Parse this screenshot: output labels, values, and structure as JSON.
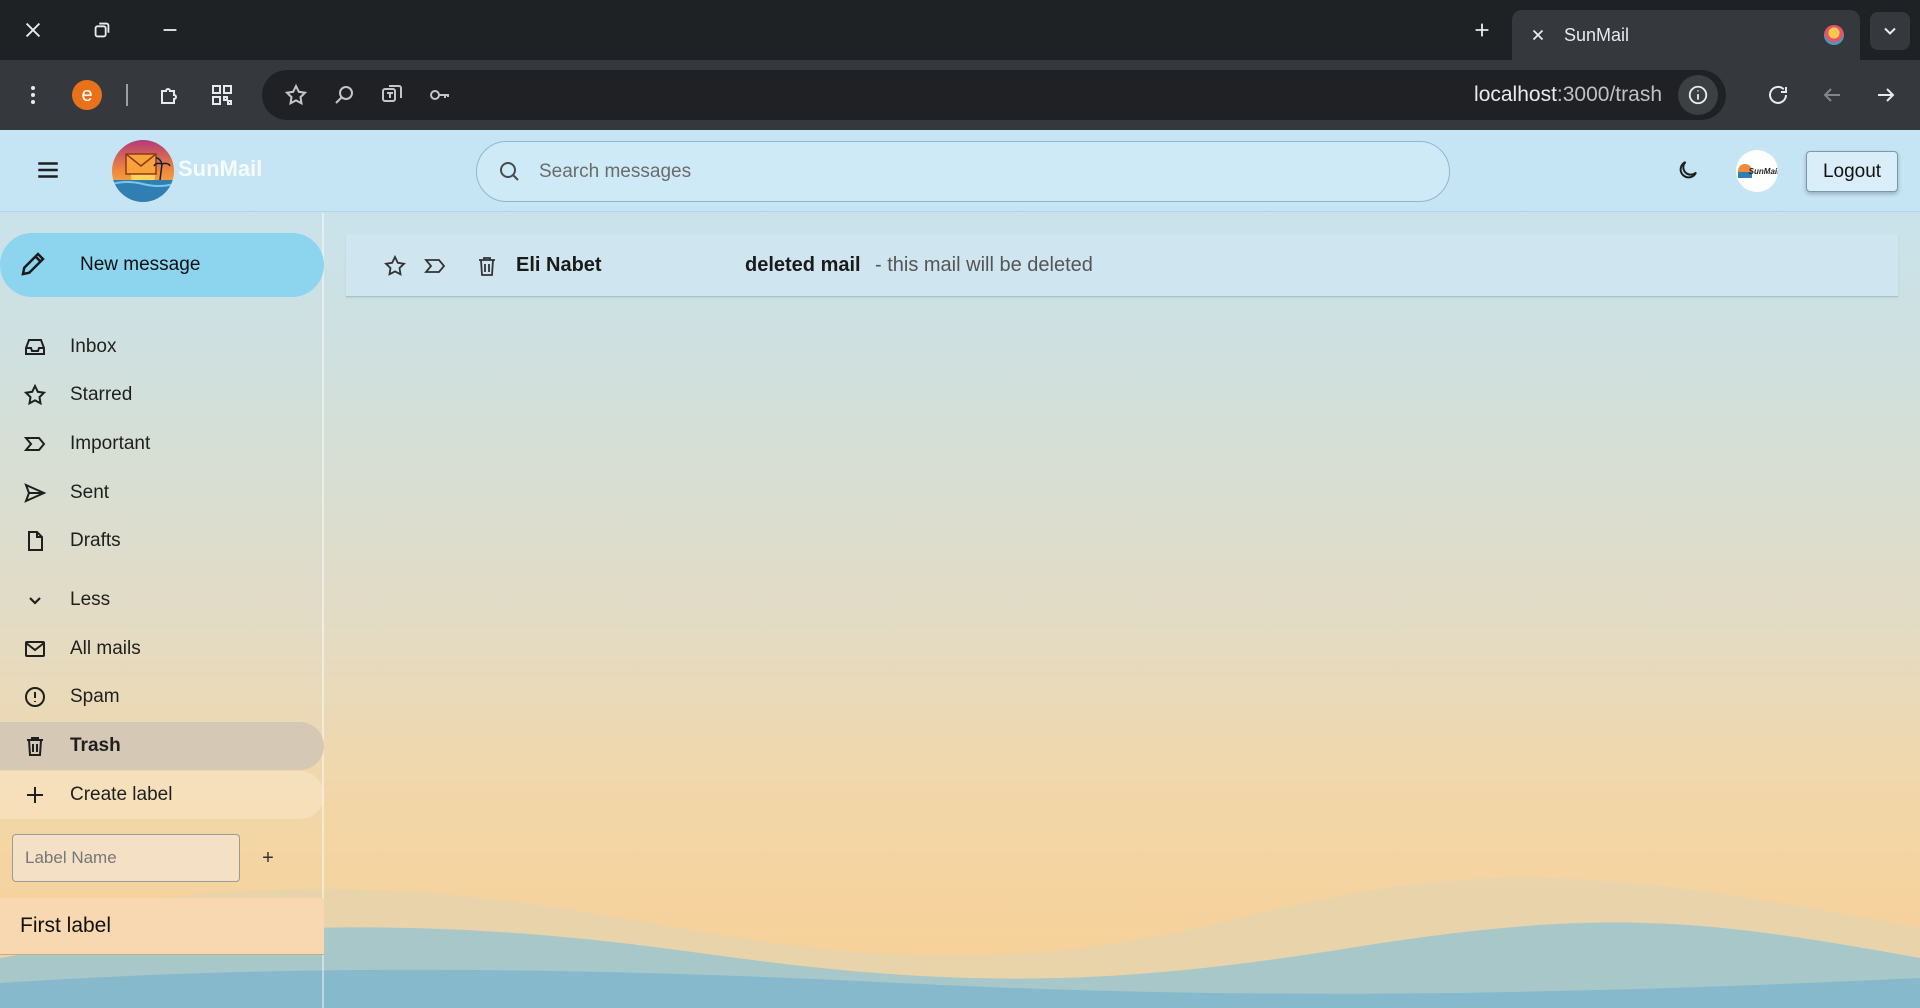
{
  "browser": {
    "tab_title": "SunMail",
    "url_host": "localhost",
    "url_path": ":3000/trash",
    "extension_letter": "e"
  },
  "app": {
    "brand": "SunMail",
    "search_placeholder": "Search messages",
    "logout_label": "Logout",
    "avatar_text": "SunMail"
  },
  "sidebar": {
    "compose_label": "New message",
    "items": [
      {
        "label": "Inbox",
        "icon": "inbox-icon"
      },
      {
        "label": "Starred",
        "icon": "star-icon"
      },
      {
        "label": "Important",
        "icon": "important-icon"
      },
      {
        "label": "Sent",
        "icon": "send-icon"
      },
      {
        "label": "Drafts",
        "icon": "draft-icon"
      },
      {
        "label": "Less",
        "icon": "chevron-down-icon"
      },
      {
        "label": "All mails",
        "icon": "mail-icon"
      },
      {
        "label": "Spam",
        "icon": "alert-icon"
      },
      {
        "label": "Trash",
        "icon": "trash-icon",
        "active": true
      },
      {
        "label": "Create label",
        "icon": "plus-icon"
      }
    ],
    "label_input_placeholder": "Label Name",
    "label_add_symbol": "+",
    "labels": [
      "First label"
    ]
  },
  "mails": [
    {
      "sender": "Eli Nabet",
      "subject": "deleted mail",
      "snippet": "- this mail will be deleted"
    }
  ],
  "colors": {
    "header_bg": "#c5e5f4",
    "compose_bg": "#8dd4ee",
    "active_item_bg": "#d5c8b5",
    "mail_row_bg": "#cfe6f1"
  }
}
